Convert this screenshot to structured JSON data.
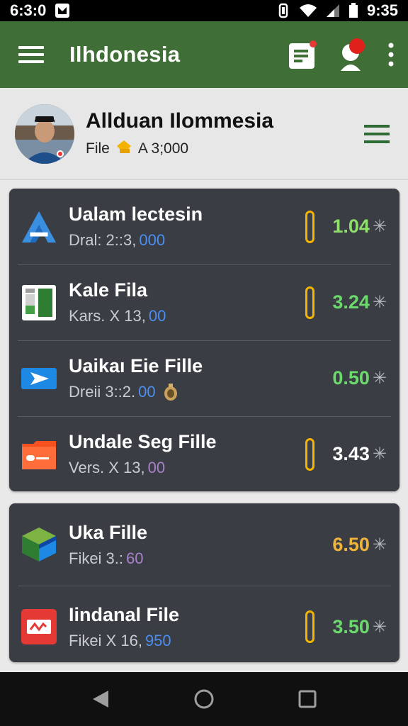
{
  "status_bar": {
    "time_left": "6:3:0",
    "time_right": "9:35"
  },
  "app_bar": {
    "title": "Ilhdonesia",
    "icons": [
      "hamburger-menu-icon",
      "document-notification-icon",
      "profile-alert-icon",
      "overflow-menu-icon"
    ]
  },
  "profile": {
    "name": "Allduan Ilommesia",
    "sub_label": "File",
    "sub_value": "A 3;000"
  },
  "files": [
    {
      "title": "Ualam lectesin",
      "sub_prefix": "Dral: 2::3,",
      "sub_highlight": "000",
      "value": "1.04",
      "value_color": "#6bd96b",
      "value_head_color": "#9be04f",
      "icon": "triangle-logo-icon",
      "pill": true
    },
    {
      "title": "Kale Fila",
      "sub_prefix": "Kars. X 13,",
      "sub_highlight": "00",
      "value": "3.24",
      "value_color": "#6bd96b",
      "value_head_color": "#6bd96b",
      "icon": "spreadsheet-icon",
      "pill": true
    },
    {
      "title": "Uaikaı Eie Fille",
      "sub_prefix": "Dreii 3::2.",
      "sub_highlight": "00",
      "value": "0.50",
      "value_color": "#6bd96b",
      "value_head_color": "#6bd96b",
      "icon": "send-arrow-icon",
      "pill": false
    },
    {
      "title": "Undale Seg Fille",
      "sub_prefix": "Vers. X 13,",
      "sub_highlight": "00",
      "value": "3.43",
      "value_color": "#ffffff",
      "value_head_color": "#ffffff",
      "icon": "orange-folder-icon",
      "pill": true
    }
  ],
  "files_2": [
    {
      "title": "Uka Fille",
      "sub_prefix": "Fikei 3.:",
      "sub_highlight": "60",
      "value": "6.50",
      "value_color": "#f1b43a",
      "value_head_color": "#f1b43a",
      "icon": "green-cube-icon",
      "pill": false
    },
    {
      "title": "Iindanal File",
      "sub_prefix": "Fikei X 16,",
      "sub_highlight": "950",
      "value": "3.50",
      "value_color": "#6bd96b",
      "value_head_color": "#6bd96b",
      "icon": "red-media-icon",
      "pill": true
    }
  ],
  "star_glyph": "✳",
  "nav_bar": {
    "icons": [
      "back-icon",
      "home-icon",
      "recents-icon"
    ]
  }
}
